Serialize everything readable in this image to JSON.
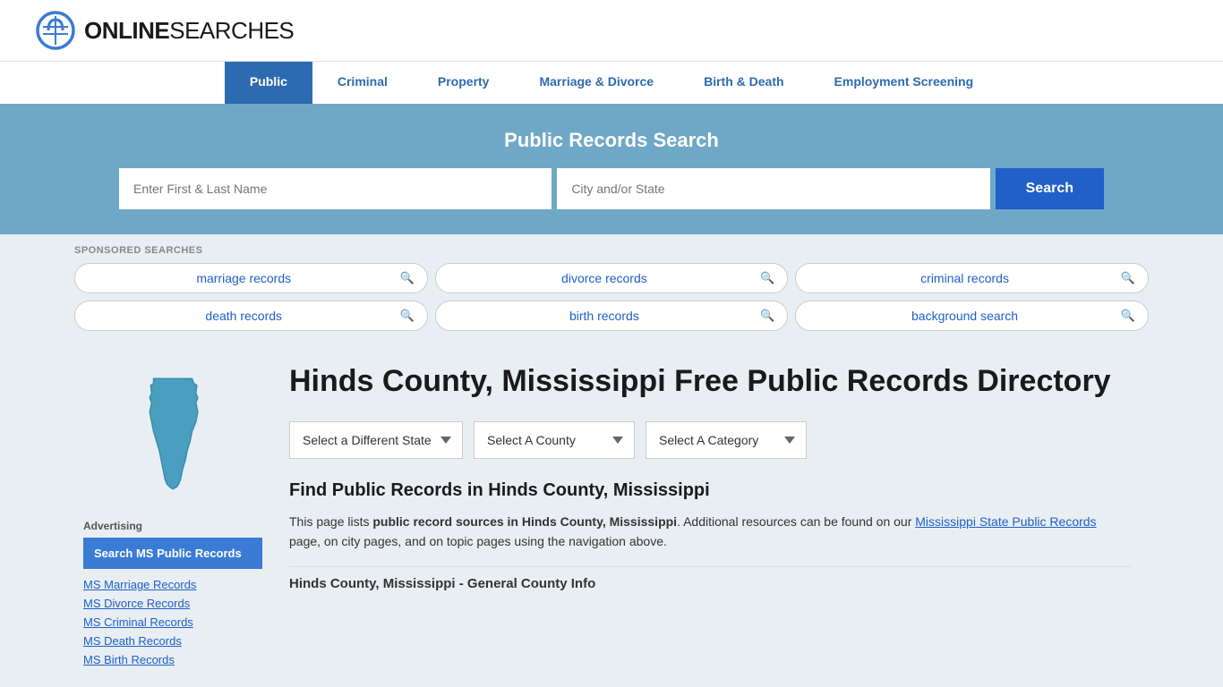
{
  "header": {
    "logo_online": "ONLINE",
    "logo_searches": "SEARCHES"
  },
  "nav": {
    "items": [
      {
        "label": "Public",
        "active": true
      },
      {
        "label": "Criminal",
        "active": false
      },
      {
        "label": "Property",
        "active": false
      },
      {
        "label": "Marriage & Divorce",
        "active": false
      },
      {
        "label": "Birth & Death",
        "active": false
      },
      {
        "label": "Employment Screening",
        "active": false
      }
    ]
  },
  "search_banner": {
    "title": "Public Records Search",
    "name_placeholder": "Enter First & Last Name",
    "location_placeholder": "City and/or State",
    "button_label": "Search"
  },
  "sponsored": {
    "label": "SPONSORED SEARCHES",
    "pills": [
      {
        "text": "marriage records"
      },
      {
        "text": "divorce records"
      },
      {
        "text": "criminal records"
      },
      {
        "text": "death records"
      },
      {
        "text": "birth records"
      },
      {
        "text": "background search"
      }
    ]
  },
  "sidebar": {
    "ad_label": "Advertising",
    "highlight_text": "Search MS Public Records",
    "links": [
      "MS Marriage Records",
      "MS Divorce Records",
      "MS Criminal Records",
      "MS Death Records",
      "MS Birth Records"
    ]
  },
  "content": {
    "page_title": "Hinds County, Mississippi Free Public Records Directory",
    "dropdowns": {
      "state_label": "Select a Different State",
      "county_label": "Select A County",
      "category_label": "Select A Category"
    },
    "find_title": "Find Public Records in Hinds County, Mississippi",
    "find_text_1": "This page lists ",
    "find_text_bold": "public record sources in Hinds County, Mississippi",
    "find_text_2": ". Additional resources can be found on our ",
    "find_link_text": "Mississippi State Public Records",
    "find_text_3": " page, on city pages, and on topic pages using the navigation above.",
    "general_info_heading": "Hinds County, Mississippi - General County Info"
  }
}
